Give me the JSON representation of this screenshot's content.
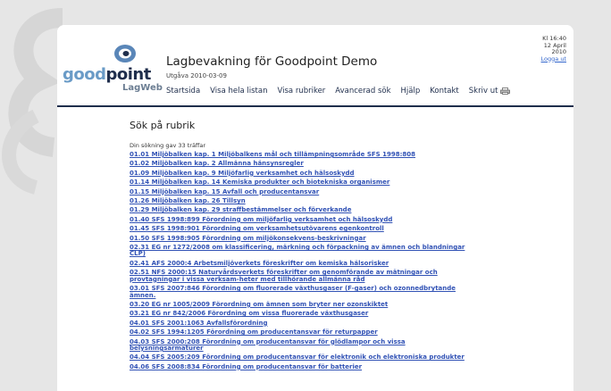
{
  "header": {
    "logo_good": "good",
    "logo_point": "point",
    "logo_sub": "LagWeb",
    "title": "Lagbevakning för Goodpoint Demo",
    "edition": "Utgåva 2010-03-09"
  },
  "nav": {
    "items": [
      "Startsida",
      "Visa hela listan",
      "Visa rubriker",
      "Avancerad sök",
      "Hjälp",
      "Kontakt"
    ],
    "print": "Skriv ut"
  },
  "meta": {
    "time": "Kl 16:40",
    "day": "12 April",
    "year": "2010",
    "logout": "Logga ut"
  },
  "content": {
    "heading": "Sök på rubrik",
    "count": "Din sökning gav 33 träffar",
    "results": [
      "01.01 Miljöbalken kap. 1 Miljöbalkens mål och tillämpningsområde SFS 1998:808",
      "01.02 Miljöbalken kap. 2 Allmänna hänsynsregler",
      "01.09 Miljöbalken kap. 9 Miljöfarlig verksamhet och hälsoskydd",
      "01.14 Miljöbalken kap. 14 Kemiska produkter och biotekniska organismer",
      "01.15 Miljöbalken kap. 15 Avfall och producentansvar",
      "01.26 Miljöbalken kap. 26 Tillsyn",
      "01.29 Miljöbalken kap. 29 straffbestämmelser och förverkande",
      "01.40 SFS 1998:899 Förordning om miljöfarlig verksamhet och hälsoskydd",
      "01.45 SFS 1998:901 Förordning om verksamhetsutövarens egenkontroll",
      "01.50 SFS 1998:905 Förordning om miljökonsekvens-beskrivningar",
      "02.31 EG nr 1272/2008 om klassificering, märkning och förpackning av ämnen och blandningar CLP)",
      "02.41 AFS 2000:4 Arbetsmiljöverkets föreskrifter om kemiska hälsorisker",
      "02.51 NFS 2000:15 Naturvårdsverkets föreskrifter om genomförande av mätningar och provtagningar i vissa verksam-heter med tillhörande allmänna råd",
      "03.01 SFS 2007:846 Förordning om fluorerade växthusgaser (F-gaser) och ozonnedbrytande ämnen.",
      "03.20 EG nr 1005/2009 Förordning om ämnen som bryter ner ozonskiktet",
      "03.21 EG nr 842/2006 Förordning om vissa fluorerade växthusgaser",
      "04.01 SFS 2001:1063 Avfallsförordning",
      "04.02 SFS 1994:1205 Förordning om producentansvar för returpapper",
      "04.03 SFS 2000:208 Förordning om producentansvar för glödlampor och vissa belysningsarmaturer",
      "04.04 SFS 2005:209 Förordning om producentansvar för elektronik och elektroniska produkter",
      "04.06 SFS 2008:834 Förordning om producentansvar för batterier"
    ]
  },
  "colors": {
    "accent_navy": "#1f2e4c",
    "logo_blue": "#6a9bc7",
    "link_blue": "#3152b5",
    "background": "#e6e6e6"
  }
}
